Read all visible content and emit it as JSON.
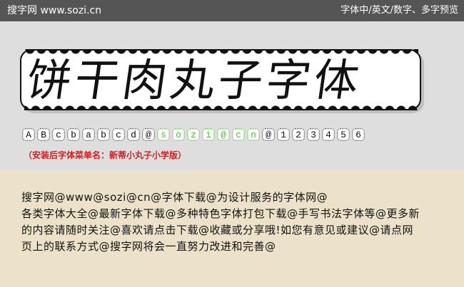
{
  "header": {
    "site": "搜字网 www.sozi.cn",
    "preview_types": "字体中/英文/数字、多字预览"
  },
  "banner": {
    "title": "饼干肉丸子字体"
  },
  "glyphs": [
    {
      "char": "A",
      "style": "black"
    },
    {
      "char": "B",
      "style": "black"
    },
    {
      "char": "c",
      "style": "black"
    },
    {
      "char": "b",
      "style": "black"
    },
    {
      "char": "a",
      "style": "black"
    },
    {
      "char": "b",
      "style": "black"
    },
    {
      "char": "c",
      "style": "black"
    },
    {
      "char": "d",
      "style": "black"
    },
    {
      "char": "@",
      "style": "black"
    },
    {
      "char": "s",
      "style": "green"
    },
    {
      "char": "o",
      "style": "green"
    },
    {
      "char": "z",
      "style": "green"
    },
    {
      "char": "i",
      "style": "green"
    },
    {
      "char": "@",
      "style": "green"
    },
    {
      "char": "c",
      "style": "green"
    },
    {
      "char": "n",
      "style": "green"
    },
    {
      "char": "@",
      "style": "black"
    },
    {
      "char": "1",
      "style": "black"
    },
    {
      "char": "2",
      "style": "black"
    },
    {
      "char": "3",
      "style": "black"
    },
    {
      "char": "4",
      "style": "black"
    },
    {
      "char": "5",
      "style": "black"
    },
    {
      "char": "6",
      "style": "black"
    }
  ],
  "install_text": "（安装后字体菜单名：新蒂小丸子小学版）",
  "description": {
    "line1": "搜字网@www@sozi@cn@字体下载@为设计服务的字体网@",
    "line2": "各类字体大全@最新字体下载@多种特色字体打包下载@手写书法字体等@更多新",
    "line3": "的内容请随时关注@喜欢请点击下载@收藏或分享哦!如您有意见或建议@请点网",
    "line4": "页上的联系方式@搜字网将会一直努力改进和完善@"
  },
  "colors": {
    "header_bg": "#555555",
    "hero_bg": "#dedede",
    "body_bg": "#ebe2c9",
    "accent_green": "#58b84a",
    "install_red": "#d51f1f"
  }
}
